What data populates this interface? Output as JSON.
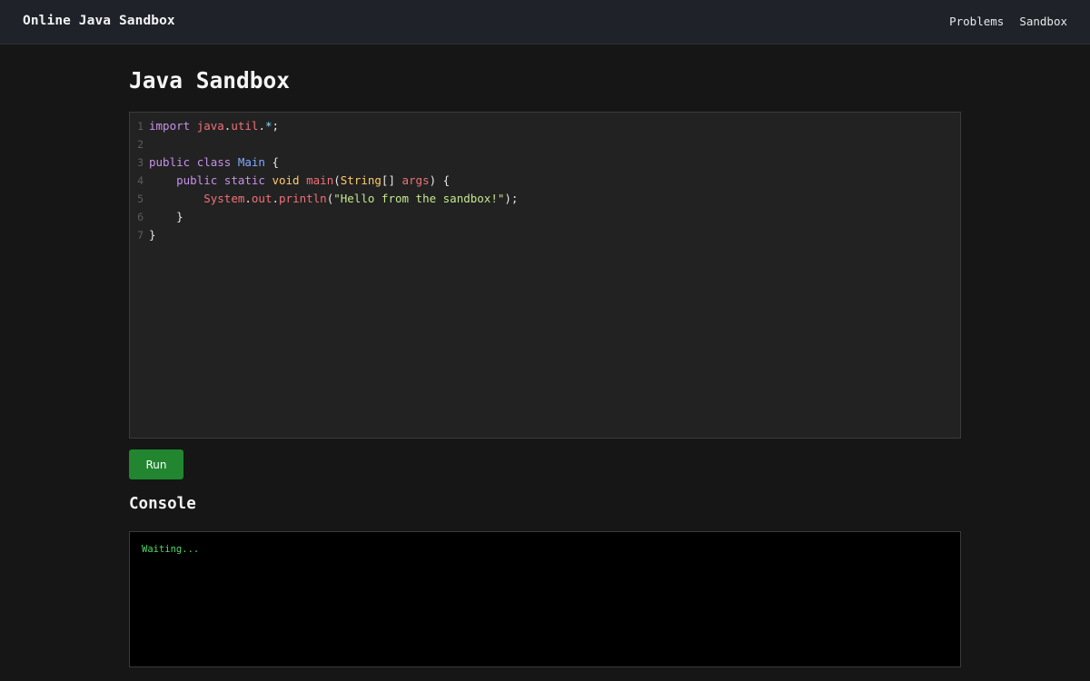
{
  "header": {
    "brand": "Online Java Sandbox",
    "nav": [
      "Problems",
      "Sandbox"
    ]
  },
  "main": {
    "title": "Java Sandbox",
    "run_label": "Run",
    "console_title": "Console",
    "console_output": "Waiting..."
  },
  "editor": {
    "line_numbers": [
      "1",
      "2",
      "3",
      "4",
      "5",
      "6",
      "7"
    ],
    "lines": [
      [
        {
          "t": "import ",
          "c": "kw"
        },
        {
          "t": "java",
          "c": "var"
        },
        {
          "t": ".",
          "c": "code"
        },
        {
          "t": "util",
          "c": "var"
        },
        {
          "t": ".",
          "c": "code"
        },
        {
          "t": "*",
          "c": "op"
        },
        {
          "t": ";",
          "c": "code"
        }
      ],
      [],
      [
        {
          "t": "public ",
          "c": "kw"
        },
        {
          "t": "class ",
          "c": "kw"
        },
        {
          "t": "Main",
          "c": "cls"
        },
        {
          "t": " {",
          "c": "code"
        }
      ],
      [
        {
          "t": "    ",
          "c": "code"
        },
        {
          "t": "public ",
          "c": "kw"
        },
        {
          "t": "static ",
          "c": "kw"
        },
        {
          "t": "void ",
          "c": "typ"
        },
        {
          "t": "main",
          "c": "var"
        },
        {
          "t": "(",
          "c": "code"
        },
        {
          "t": "String",
          "c": "typ"
        },
        {
          "t": "[] ",
          "c": "code"
        },
        {
          "t": "args",
          "c": "var"
        },
        {
          "t": ") {",
          "c": "code"
        }
      ],
      [
        {
          "t": "        ",
          "c": "code"
        },
        {
          "t": "System",
          "c": "var"
        },
        {
          "t": ".",
          "c": "code"
        },
        {
          "t": "out",
          "c": "var"
        },
        {
          "t": ".",
          "c": "code"
        },
        {
          "t": "println",
          "c": "var"
        },
        {
          "t": "(",
          "c": "code"
        },
        {
          "t": "\"Hello from the sandbox!\"",
          "c": "str"
        },
        {
          "t": ");",
          "c": "code"
        }
      ],
      [
        {
          "t": "    }",
          "c": "code"
        }
      ],
      [
        {
          "t": "}",
          "c": "code"
        }
      ]
    ]
  },
  "colors": {
    "run_button": "#21862f",
    "console_text": "#4cd964",
    "keyword": "#c792ea",
    "class_name": "#82aaff",
    "identifier": "#f07178",
    "type": "#ffcb6b",
    "string": "#c3e88d"
  }
}
